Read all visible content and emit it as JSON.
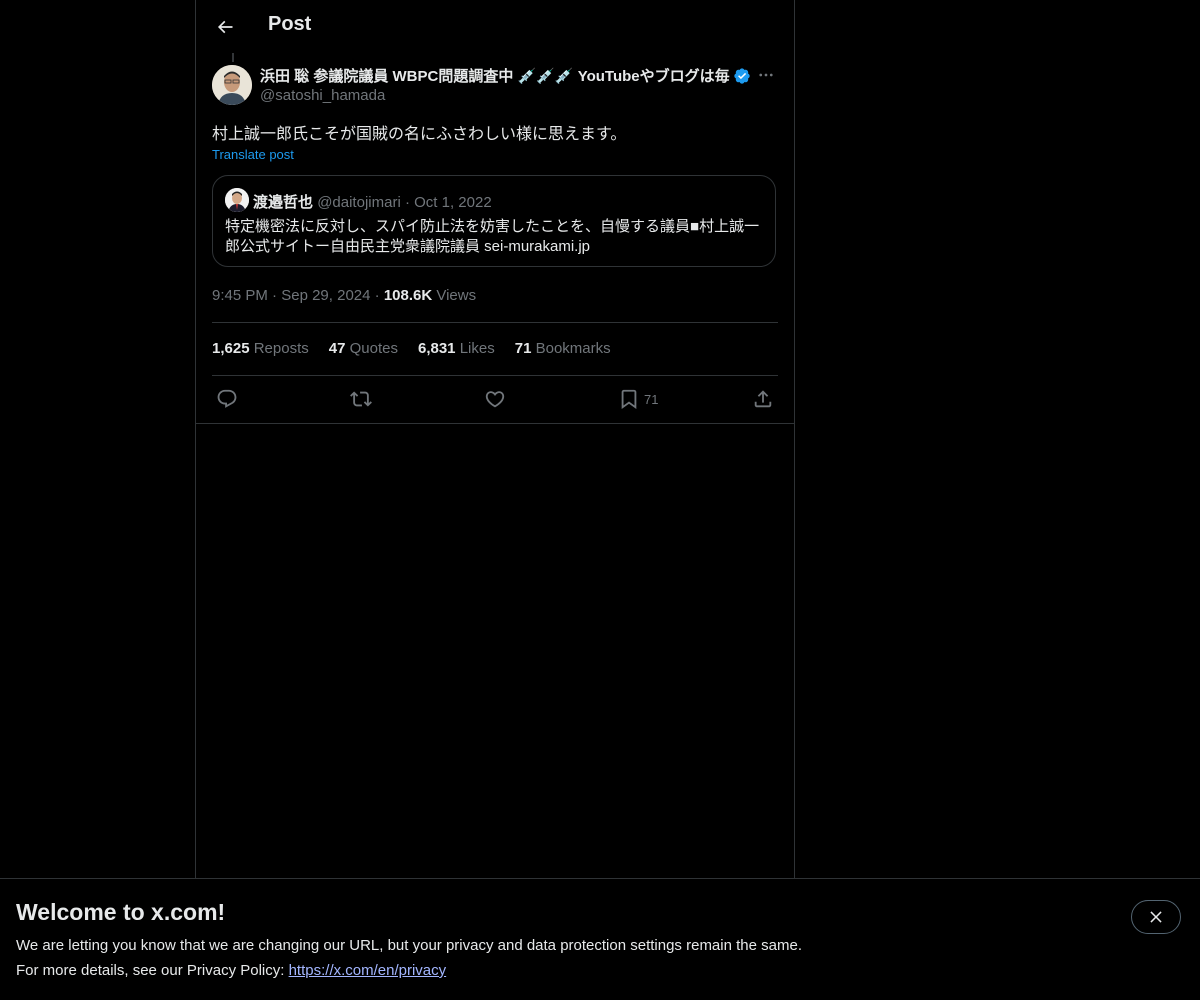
{
  "header": {
    "title": "Post"
  },
  "post": {
    "author": {
      "display_name": "浜田 聡 参議院議員 WBPC問題調査中 💉💉💉 YouTubeやブログは毎",
      "handle": "@satoshi_hamada",
      "verified": true
    },
    "text": "村上誠一郎氏こそが国賊の名にふさわしい様に思えます。",
    "translate_label": "Translate post",
    "quote": {
      "author_name": "渡邉哲也",
      "author_handle": "@daitojimari",
      "separator": "·",
      "date": "Oct 1, 2022",
      "text": "特定機密法に反対し、スパイ防止法を妨害したことを、自慢する議員■村上誠一郎公式サイトー自由民主党衆議院議員 sei-murakami.jp"
    },
    "meta": {
      "time": "9:45 PM",
      "date": "Sep 29, 2024",
      "separator": "·",
      "views_count": "108.6K",
      "views_label": "Views"
    },
    "stats": {
      "reposts_count": "1,625",
      "reposts_label": "Reposts",
      "quotes_count": "47",
      "quotes_label": "Quotes",
      "likes_count": "6,831",
      "likes_label": "Likes",
      "bookmarks_count": "71",
      "bookmarks_label": "Bookmarks"
    },
    "actions": {
      "reply_icon": "reply-icon",
      "repost_icon": "repost-icon",
      "like_icon": "heart-icon",
      "bookmark_icon": "bookmark-icon",
      "bookmark_count": "71",
      "share_icon": "share-icon"
    }
  },
  "banner": {
    "title": "Welcome to x.com!",
    "line1": "We are letting you know that we are changing our URL, but your privacy and data protection settings remain the same.",
    "line2_prefix": "For more details, see our Privacy Policy: ",
    "link_text": "https://x.com/en/privacy"
  },
  "colors": {
    "background": "#000000",
    "text": "#e7e9ea",
    "muted": "#71767b",
    "accent": "#1d9bf0",
    "border": "#2f3336"
  }
}
